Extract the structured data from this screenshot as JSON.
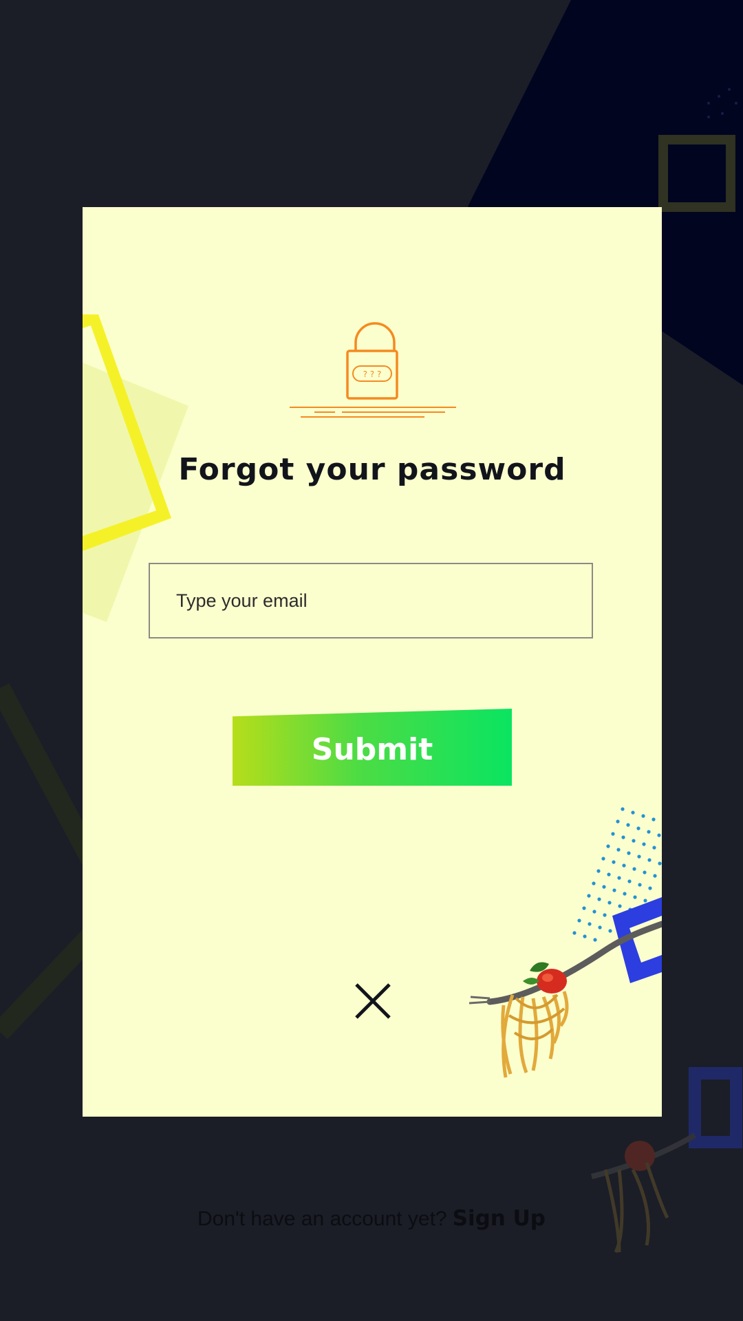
{
  "modal": {
    "title": "Forgot your password",
    "email_placeholder": "Type your email",
    "email_value": "",
    "submit_label": "Submit",
    "lock_icon_text": "? ? ?"
  },
  "footer": {
    "prompt": "Don't have an account yet?",
    "signup_label": "Sign Up"
  },
  "colors": {
    "background": "#1b1e27",
    "modal_bg": "#fbffcd",
    "accent_orange": "#f58a1f",
    "button_gradient_start": "#b6dd1a",
    "button_gradient_end": "#0ae461",
    "deco_yellow": "#f5f128",
    "deco_blue": "#2c3ee0"
  },
  "icons": [
    "lock-icon",
    "close-icon",
    "pasta-fork-image"
  ]
}
